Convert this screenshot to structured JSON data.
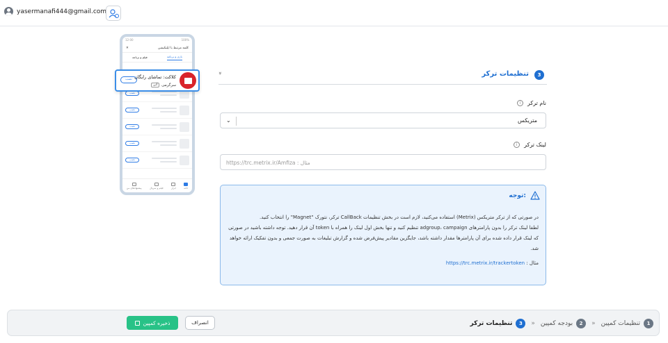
{
  "topbar": {
    "user_email": "yasermanafi444@gmail.com",
    "chevron": "⌄",
    "add_user_icon": "add-user-icon"
  },
  "phone": {
    "status_time": "12:00",
    "status_battery": "100%",
    "header_title": "کلمه مرتبط با اپلیکیشن",
    "tabs": [
      "بازی و برنامه",
      "فیلم و برنامه"
    ],
    "install_label": "نصب",
    "nav_items": [
      "خانه",
      "ابزار",
      "فیلم و سریال",
      "پیشنهادهای من"
    ],
    "highlight": {
      "name": "کلاکت: تماشای رایگان",
      "category": "سرگرمی",
      "tag": "آنی",
      "install": "نصب"
    }
  },
  "section": {
    "number": "3",
    "title": "تنظیمات ترکر",
    "collapse_icon": "»"
  },
  "tracker_name": {
    "label": "نام ترکر",
    "value": "متریکس",
    "info": "i"
  },
  "tracker_link": {
    "label": "لینک ترکر",
    "placeholder": "https://trc.metrix.ir/Amfiza : مثال",
    "info": "i"
  },
  "notice": {
    "title": "توجه:",
    "line1": "در صورتی که از ترکر متریکس (Metrix) استفاده می‌کنید، لازم است در بخش تنظیمات CallBack ترکر، نتورک \"Magnet\" را انتخاب کنید.",
    "line2": "لطفا لینک ترکر را بدون پارامترهای adgroup، campaign تنظیم کنید و تنها بخش اول لینک را همراه با token آن قرار دهید. توجه داشته باشید در صورتی که لینک قرار داده شده برای آن پارامترها مقدار داشته باشد، جایگزین مقادیر پیش‌فرض شده و گزارش تبلیغات به صورت جمعی و بدون تفکیک ارائه خواهد شد.",
    "example_prefix": "مثال :",
    "example_link": "https://trc.metrix.ir/trackertoken"
  },
  "footer": {
    "steps": [
      {
        "number": "1",
        "label": "تنظیمات کمپین"
      },
      {
        "number": "2",
        "label": "بودجه کمپین"
      },
      {
        "number": "3",
        "label": "تنظیمات ترکر"
      }
    ],
    "separator": "»",
    "cancel_label": "انصراف",
    "save_label": "ذخیره کمپین"
  },
  "colors": {
    "accent": "#1f6fd1",
    "save": "#28c287",
    "notice_bg": "#eaf3fd"
  }
}
